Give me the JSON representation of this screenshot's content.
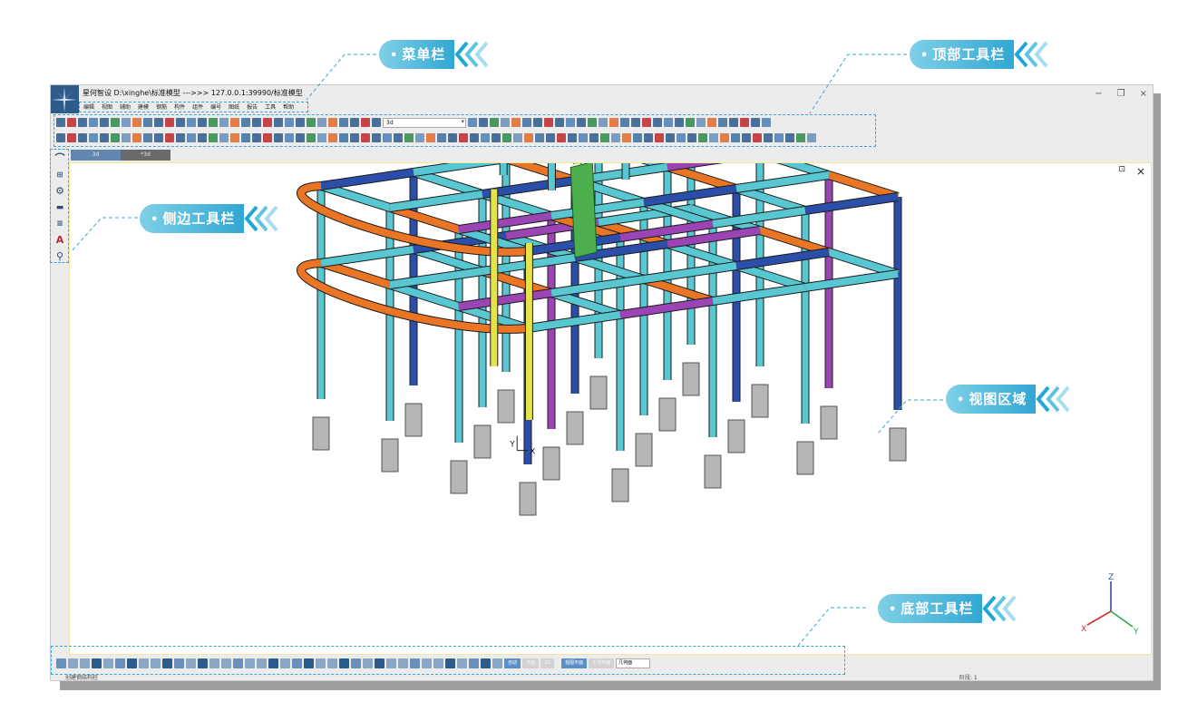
{
  "window": {
    "title": "星何智设  D:\\xinghe\\标准模型 --->>> 127.0.0.1:39990/标准模型",
    "controls": [
      "−",
      "❐",
      "×"
    ]
  },
  "menu": [
    "编辑",
    "视图",
    "辅助",
    "建模",
    "钢筋",
    "构件",
    "组件",
    "编号",
    "图纸",
    "报告",
    "工具",
    "帮助"
  ],
  "toolbar": {
    "view_combo_value": "3d"
  },
  "tabs": [
    {
      "label": "3d",
      "active": true
    },
    {
      "label": "*3d",
      "active": false
    }
  ],
  "sidebar_icons": [
    "arc-icon",
    "grid-axis-icon",
    "model-settings-icon",
    "truck-icon",
    "layer-icon",
    "text-annotation-icon",
    "location-pin-icon"
  ],
  "viewport": {
    "close_label": "×",
    "axis_labels": {
      "z": "Z",
      "x": "X",
      "y": "Y"
    },
    "local_axis": {
      "y": "Y",
      "x": "X"
    }
  },
  "bottom_toolbar": {
    "buttons": [
      "自动",
      "平面",
      "3D",
      "视图平面",
      "工作平面"
    ],
    "face_combo_value": "几何面"
  },
  "status": {
    "command": "创建钢结构柱",
    "stage": "阶段: 1"
  },
  "callouts": {
    "menu_bar": "菜单栏",
    "top_toolbar": "顶部工具栏",
    "side_toolbar": "侧边工具栏",
    "view_area": "视图区域",
    "bottom_toolbar": "底部工具栏"
  },
  "colors": {
    "accent": "#31a7d4",
    "beam_cyan": "#58c7d1",
    "beam_orange": "#e97525",
    "beam_purple": "#9a45b3",
    "beam_blue": "#2b4fa8",
    "beam_yellow": "#e5e345",
    "column_grey": "#b5b5b5",
    "stair_green": "#4cae4c"
  }
}
